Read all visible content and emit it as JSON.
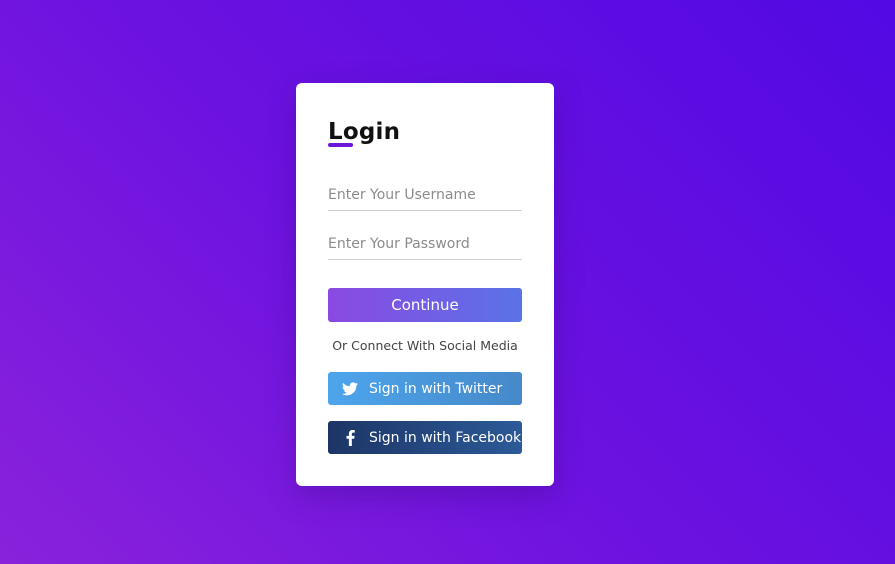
{
  "login": {
    "title": "Login",
    "username": {
      "placeholder": "Enter Your Username",
      "value": ""
    },
    "password": {
      "placeholder": "Enter Your Password",
      "value": ""
    },
    "continue_label": "Continue",
    "social_text": "Or Connect With Social Media",
    "twitter_label": "Sign in with Twitter",
    "facebook_label": "Sign in with Facebook"
  },
  "icons": {
    "twitter": "twitter-icon",
    "facebook": "facebook-icon"
  },
  "colors": {
    "background_start": "#8a22db",
    "background_end": "#5209e3",
    "accent": "#6a17d8",
    "continue_start": "#8a49e3",
    "continue_end": "#5a73e6",
    "twitter": "#4da5ec",
    "facebook": "#1d3566"
  }
}
